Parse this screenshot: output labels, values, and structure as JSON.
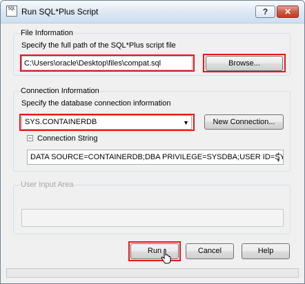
{
  "window": {
    "title": "Run SQL*Plus Script",
    "icon_text": "SQL",
    "help_label": "?",
    "close_label": "✕"
  },
  "file_info": {
    "legend": "File Information",
    "instruction": "Specify the full path of the SQL*Plus script file",
    "path_value": "C:\\Users\\oracle\\Desktop\\files\\compat.sql",
    "browse_label": "Browse..."
  },
  "connection": {
    "legend": "Connection Information",
    "instruction": "Specify the database connection information",
    "selected": "SYS.CONTAINERDB",
    "new_connection_label": "New Connection...",
    "string_toggle_label": "Connection String",
    "connection_string": "DATA SOURCE=CONTAINERDB;DBA PRIVILEGE=SYSDBA;USER ID=SYS"
  },
  "user_input": {
    "legend": "User Input Area"
  },
  "buttons": {
    "run": "Run",
    "cancel": "Cancel",
    "help": "Help"
  },
  "colors": {
    "highlight": "#e8161c"
  }
}
